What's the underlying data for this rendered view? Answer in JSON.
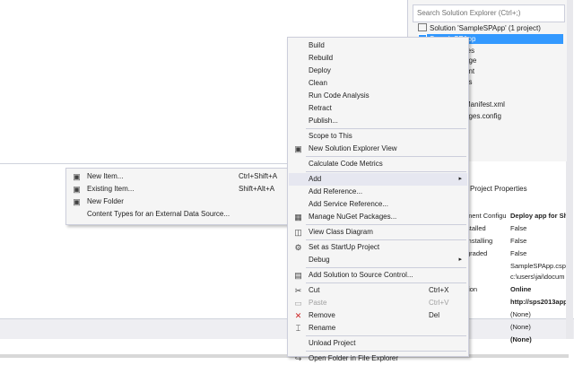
{
  "solution_explorer": {
    "search_placeholder": "Search Solution Explorer (Ctrl+;)",
    "rows": [
      {
        "label": "Solution 'SampleSPApp' (1 project)"
      },
      {
        "label": "SampleSPApp",
        "selected": true
      },
      {
        "label": "res"
      },
      {
        "label": "age"
      },
      {
        "label": "ent"
      },
      {
        "label": "es"
      },
      {
        "label": "s"
      },
      {
        "label": "Manifest.xml"
      },
      {
        "label": "ages.config"
      }
    ]
  },
  "properties": {
    "title": "Project Properties",
    "rows": [
      {
        "key": "ment Configu",
        "value": "Deploy app for Sha",
        "bold": true
      },
      {
        "key": "stalled",
        "value": "False"
      },
      {
        "key": "installing",
        "value": "False"
      },
      {
        "key": "graded",
        "value": "False"
      },
      {
        "key": "",
        "value": "SampleSPApp.cspro"
      },
      {
        "key": "",
        "value": "c:\\users\\jai\\docum"
      },
      {
        "key": "tion",
        "value": "Online",
        "bold": true
      },
      {
        "key": "",
        "value": "http://sps2013app",
        "bold": true
      },
      {
        "key": "",
        "value": "(None)"
      },
      {
        "key": "",
        "value": "(None)"
      },
      {
        "key": "",
        "value": "(None)",
        "bold": true
      }
    ]
  },
  "context_menu": {
    "items": [
      {
        "type": "item",
        "label": "Build",
        "icon": "build-icon",
        "glyph": ""
      },
      {
        "type": "item",
        "label": "Rebuild",
        "icon": "",
        "glyph": ""
      },
      {
        "type": "item",
        "label": "Deploy",
        "icon": "",
        "glyph": ""
      },
      {
        "type": "item",
        "label": "Clean",
        "icon": "",
        "glyph": ""
      },
      {
        "type": "item",
        "label": "Run Code Analysis",
        "icon": "",
        "glyph": ""
      },
      {
        "type": "item",
        "label": "Retract",
        "icon": "",
        "glyph": ""
      },
      {
        "type": "item",
        "label": "Publish...",
        "icon": "",
        "glyph": ""
      },
      {
        "type": "sep"
      },
      {
        "type": "item",
        "label": "Scope to This",
        "icon": "",
        "glyph": ""
      },
      {
        "type": "item",
        "label": "New Solution Explorer View",
        "icon": "new-view-icon",
        "glyph": "▣"
      },
      {
        "type": "sep"
      },
      {
        "type": "item",
        "label": "Calculate Code Metrics",
        "icon": "",
        "glyph": ""
      },
      {
        "type": "sep"
      },
      {
        "type": "item",
        "label": "Add",
        "icon": "",
        "glyph": "",
        "submenu": true,
        "highlight": true
      },
      {
        "type": "item",
        "label": "Add Reference...",
        "icon": "",
        "glyph": ""
      },
      {
        "type": "item",
        "label": "Add Service Reference...",
        "icon": "",
        "glyph": ""
      },
      {
        "type": "item",
        "label": "Manage NuGet Packages...",
        "icon": "nuget-icon",
        "glyph": "▦"
      },
      {
        "type": "sep"
      },
      {
        "type": "item",
        "label": "View Class Diagram",
        "icon": "class-diagram-icon",
        "glyph": "◫"
      },
      {
        "type": "sep"
      },
      {
        "type": "item",
        "label": "Set as StartUp Project",
        "icon": "startup-gear-icon",
        "glyph": "⚙"
      },
      {
        "type": "item",
        "label": "Debug",
        "icon": "",
        "glyph": "",
        "submenu": true
      },
      {
        "type": "sep"
      },
      {
        "type": "item",
        "label": "Add Solution to Source Control...",
        "icon": "source-control-icon",
        "glyph": "▤"
      },
      {
        "type": "sep"
      },
      {
        "type": "item",
        "label": "Cut",
        "icon": "scissors-icon",
        "glyph": "✂",
        "shortcut": "Ctrl+X"
      },
      {
        "type": "item",
        "label": "Paste",
        "icon": "paste-icon",
        "glyph": "▭",
        "shortcut": "Ctrl+V",
        "disabled": true
      },
      {
        "type": "item",
        "label": "Remove",
        "icon": "remove-x-icon",
        "glyph": "✕",
        "shortcut": "Del",
        "red": true
      },
      {
        "type": "item",
        "label": "Rename",
        "icon": "rename-icon",
        "glyph": "⌶"
      },
      {
        "type": "sep"
      },
      {
        "type": "item",
        "label": "Unload Project",
        "icon": "",
        "glyph": ""
      },
      {
        "type": "sep"
      },
      {
        "type": "item",
        "label": "Open Folder in File Explorer",
        "icon": "open-folder-icon",
        "glyph": "↪"
      }
    ]
  },
  "add_submenu": {
    "items": [
      {
        "label": "New Item...",
        "shortcut": "Ctrl+Shift+A",
        "icon": "new-item-icon",
        "glyph": "▣"
      },
      {
        "label": "Existing Item...",
        "shortcut": "Shift+Alt+A",
        "icon": "existing-item-icon",
        "glyph": "▣"
      },
      {
        "label": "New Folder",
        "shortcut": "",
        "icon": "new-folder-icon",
        "glyph": "▣"
      },
      {
        "label": "Content Types for an External Data Source...",
        "shortcut": "",
        "icon": "",
        "glyph": ""
      }
    ]
  },
  "colors": {
    "selection": "#3399ff",
    "menu_bg": "#f5f5f5",
    "highlight": "#e6e7f0",
    "remove": "#cc2222"
  }
}
